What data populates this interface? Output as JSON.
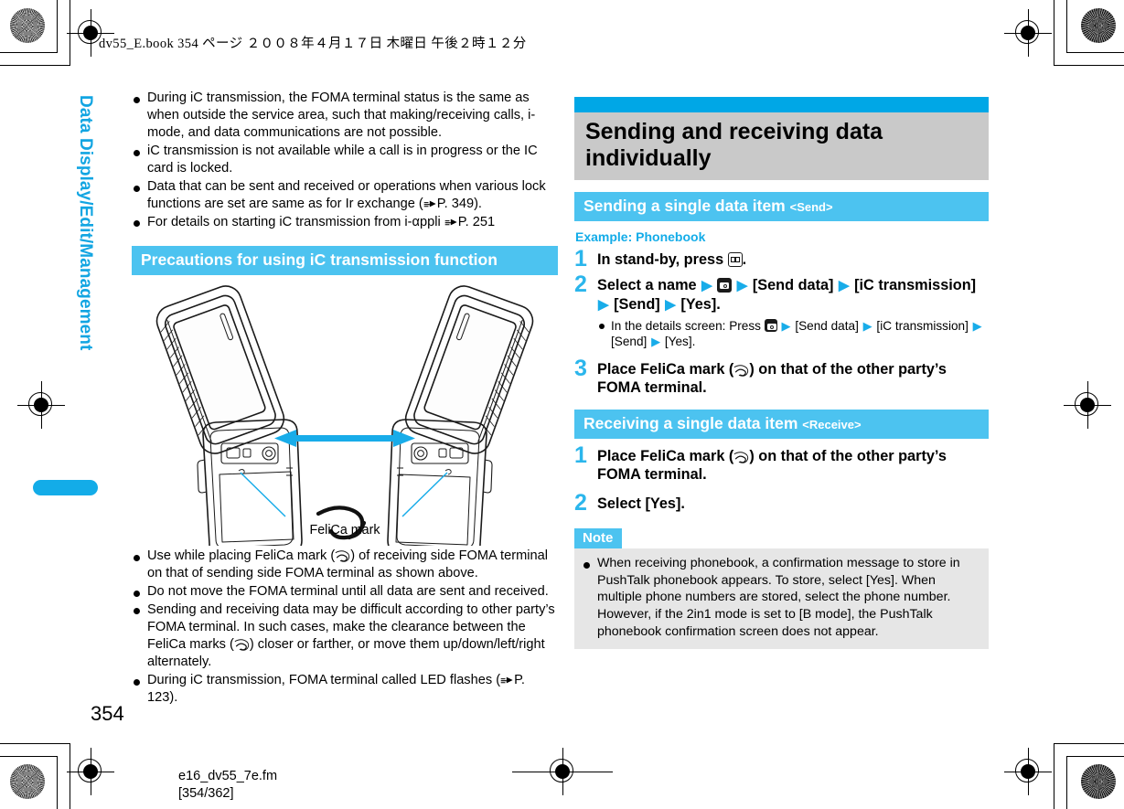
{
  "page": {
    "header_line": "dv55_E.book   354 ページ   ２００８年４月１７日   木曜日   午後２時１２分",
    "side_tab": "Data Display/Edit/Management",
    "page_number": "354",
    "file_name": "e16_dv55_7e.fm",
    "page_range": "[354/362]"
  },
  "colors": {
    "accent_blue": "#00a7e6",
    "bar_blue": "#4cc3f0",
    "step_blue": "#2bb6ec",
    "heading_grey": "#c9c9c9",
    "note_grey": "#e6e6e6"
  },
  "left_column": {
    "intro_bullets": [
      "During iC transmission, the FOMA terminal status is the same as when outside the service area, such that making/receiving calls, i-mode, and data communications are not possible.",
      "iC transmission is not available while a call is in progress or the IC card is locked.",
      "Data that can be sent and received or operations when various lock functions are set are same as for Ir exchange (☞P. 349).",
      "For details on starting iC transmission from i-αppli ☞P. 251"
    ],
    "section_bar": "Precautions for using iC transmission function",
    "illustration_caption": "FeliCa mark",
    "precaution_bullets": [
      "Use while placing FeliCa mark (ⓕ) of receiving side FOMA terminal on that of sending side FOMA terminal as shown above.",
      "Do not move the FOMA terminal until all data are sent and received.",
      "Sending and receiving data may be difficult according to other party’s FOMA terminal. In such cases, make the clearance between the FeliCa marks (ⓕ) closer or farther, or move them up/down/left/right alternately.",
      "During iC transmission, FOMA terminal called LED flashes (☞P. 123)."
    ]
  },
  "right_column": {
    "main_heading": "Sending and receiving data individually",
    "send_section": {
      "title": "Sending a single data item",
      "tag": "<Send>",
      "example_label": "Example: Phonebook",
      "steps": [
        {
          "number": "1",
          "text_before": "In stand-by, press",
          "text_after": "."
        },
        {
          "number": "2",
          "part1": "Select a name",
          "part2": "[Send data]",
          "part3": "[iC transmission]",
          "part4": "[Send]",
          "part5": "[Yes].",
          "sub_bullet": {
            "lead": "In the details screen: Press",
            "p2": "[Send data]",
            "p3": "[iC transmission]",
            "p4": "[Send]",
            "p5": "[Yes]."
          }
        },
        {
          "number": "3",
          "text": "Place FeliCa mark (ⓕ) on that of the other party’s FOMA terminal."
        }
      ]
    },
    "receive_section": {
      "title": "Receiving a single data item",
      "tag": "<Receive>",
      "steps": [
        {
          "number": "1",
          "text": "Place FeliCa mark (ⓕ) on that of the other party’s FOMA terminal."
        },
        {
          "number": "2",
          "text": "Select [Yes]."
        }
      ]
    },
    "note": {
      "label": "Note",
      "bullets": [
        "When receiving phonebook, a confirmation message to store in PushTalk phonebook appears. To store, select [Yes]. When multiple phone numbers are stored, select the phone number. However, if the 2in1 mode is set to [B mode], the PushTalk phonebook confirmation screen does not appear."
      ]
    }
  }
}
